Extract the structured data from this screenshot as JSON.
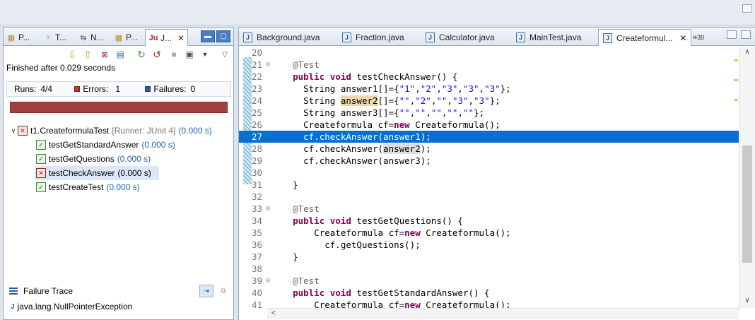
{
  "left_panel": {
    "tabs": [
      {
        "label": "P...",
        "icon": "package-explorer-icon"
      },
      {
        "label": "T...",
        "icon": "type-hierarchy-icon"
      },
      {
        "label": "N...",
        "icon": "navigator-icon"
      },
      {
        "label": "P...",
        "icon": "project-explorer-icon"
      },
      {
        "label": "J...",
        "icon": "junit-icon",
        "active": true
      }
    ],
    "status": "Finished after 0.029 seconds",
    "runs_label": "Runs:",
    "runs_value": "4/4",
    "errors_label": "Errors:",
    "errors_value": "1",
    "failures_label": "Failures:",
    "failures_value": "0",
    "progress_color": "#a0403a",
    "tree": {
      "root_label": "t1.CreateformulaTest",
      "root_runner": "[Runner: JUnit 4]",
      "root_time": "(0.000 s)",
      "children": [
        {
          "label": "testGetStandardAnswer",
          "time": "(0.000 s)",
          "status": "pass"
        },
        {
          "label": "testGetQuestions",
          "time": "(0.000 s)",
          "status": "pass"
        },
        {
          "label": "testCheckAnswer",
          "time": "(0.000 s)",
          "status": "error",
          "selected": true
        },
        {
          "label": "testCreateTest",
          "time": "(0.000 s)",
          "status": "pass"
        }
      ]
    },
    "failure_trace_title": "Failure Trace",
    "trace_line": "java.lang.NullPointerException"
  },
  "editor": {
    "tabs": [
      {
        "label": "Background.java"
      },
      {
        "label": "Fraction.java"
      },
      {
        "label": "Calculator.java"
      },
      {
        "label": "MainTest.java"
      },
      {
        "label": "Createformul...",
        "active": true
      }
    ],
    "overflow_label": "»",
    "overflow_count": "30",
    "line_numbers": [
      "20",
      "21",
      "22",
      "23",
      "24",
      "25",
      "26",
      "27",
      "28",
      "29",
      "30",
      "31",
      "32",
      "33",
      "34",
      "35",
      "36",
      "37",
      "38",
      "39",
      "40",
      "41"
    ],
    "highlight_color": "#0a6fd0"
  }
}
